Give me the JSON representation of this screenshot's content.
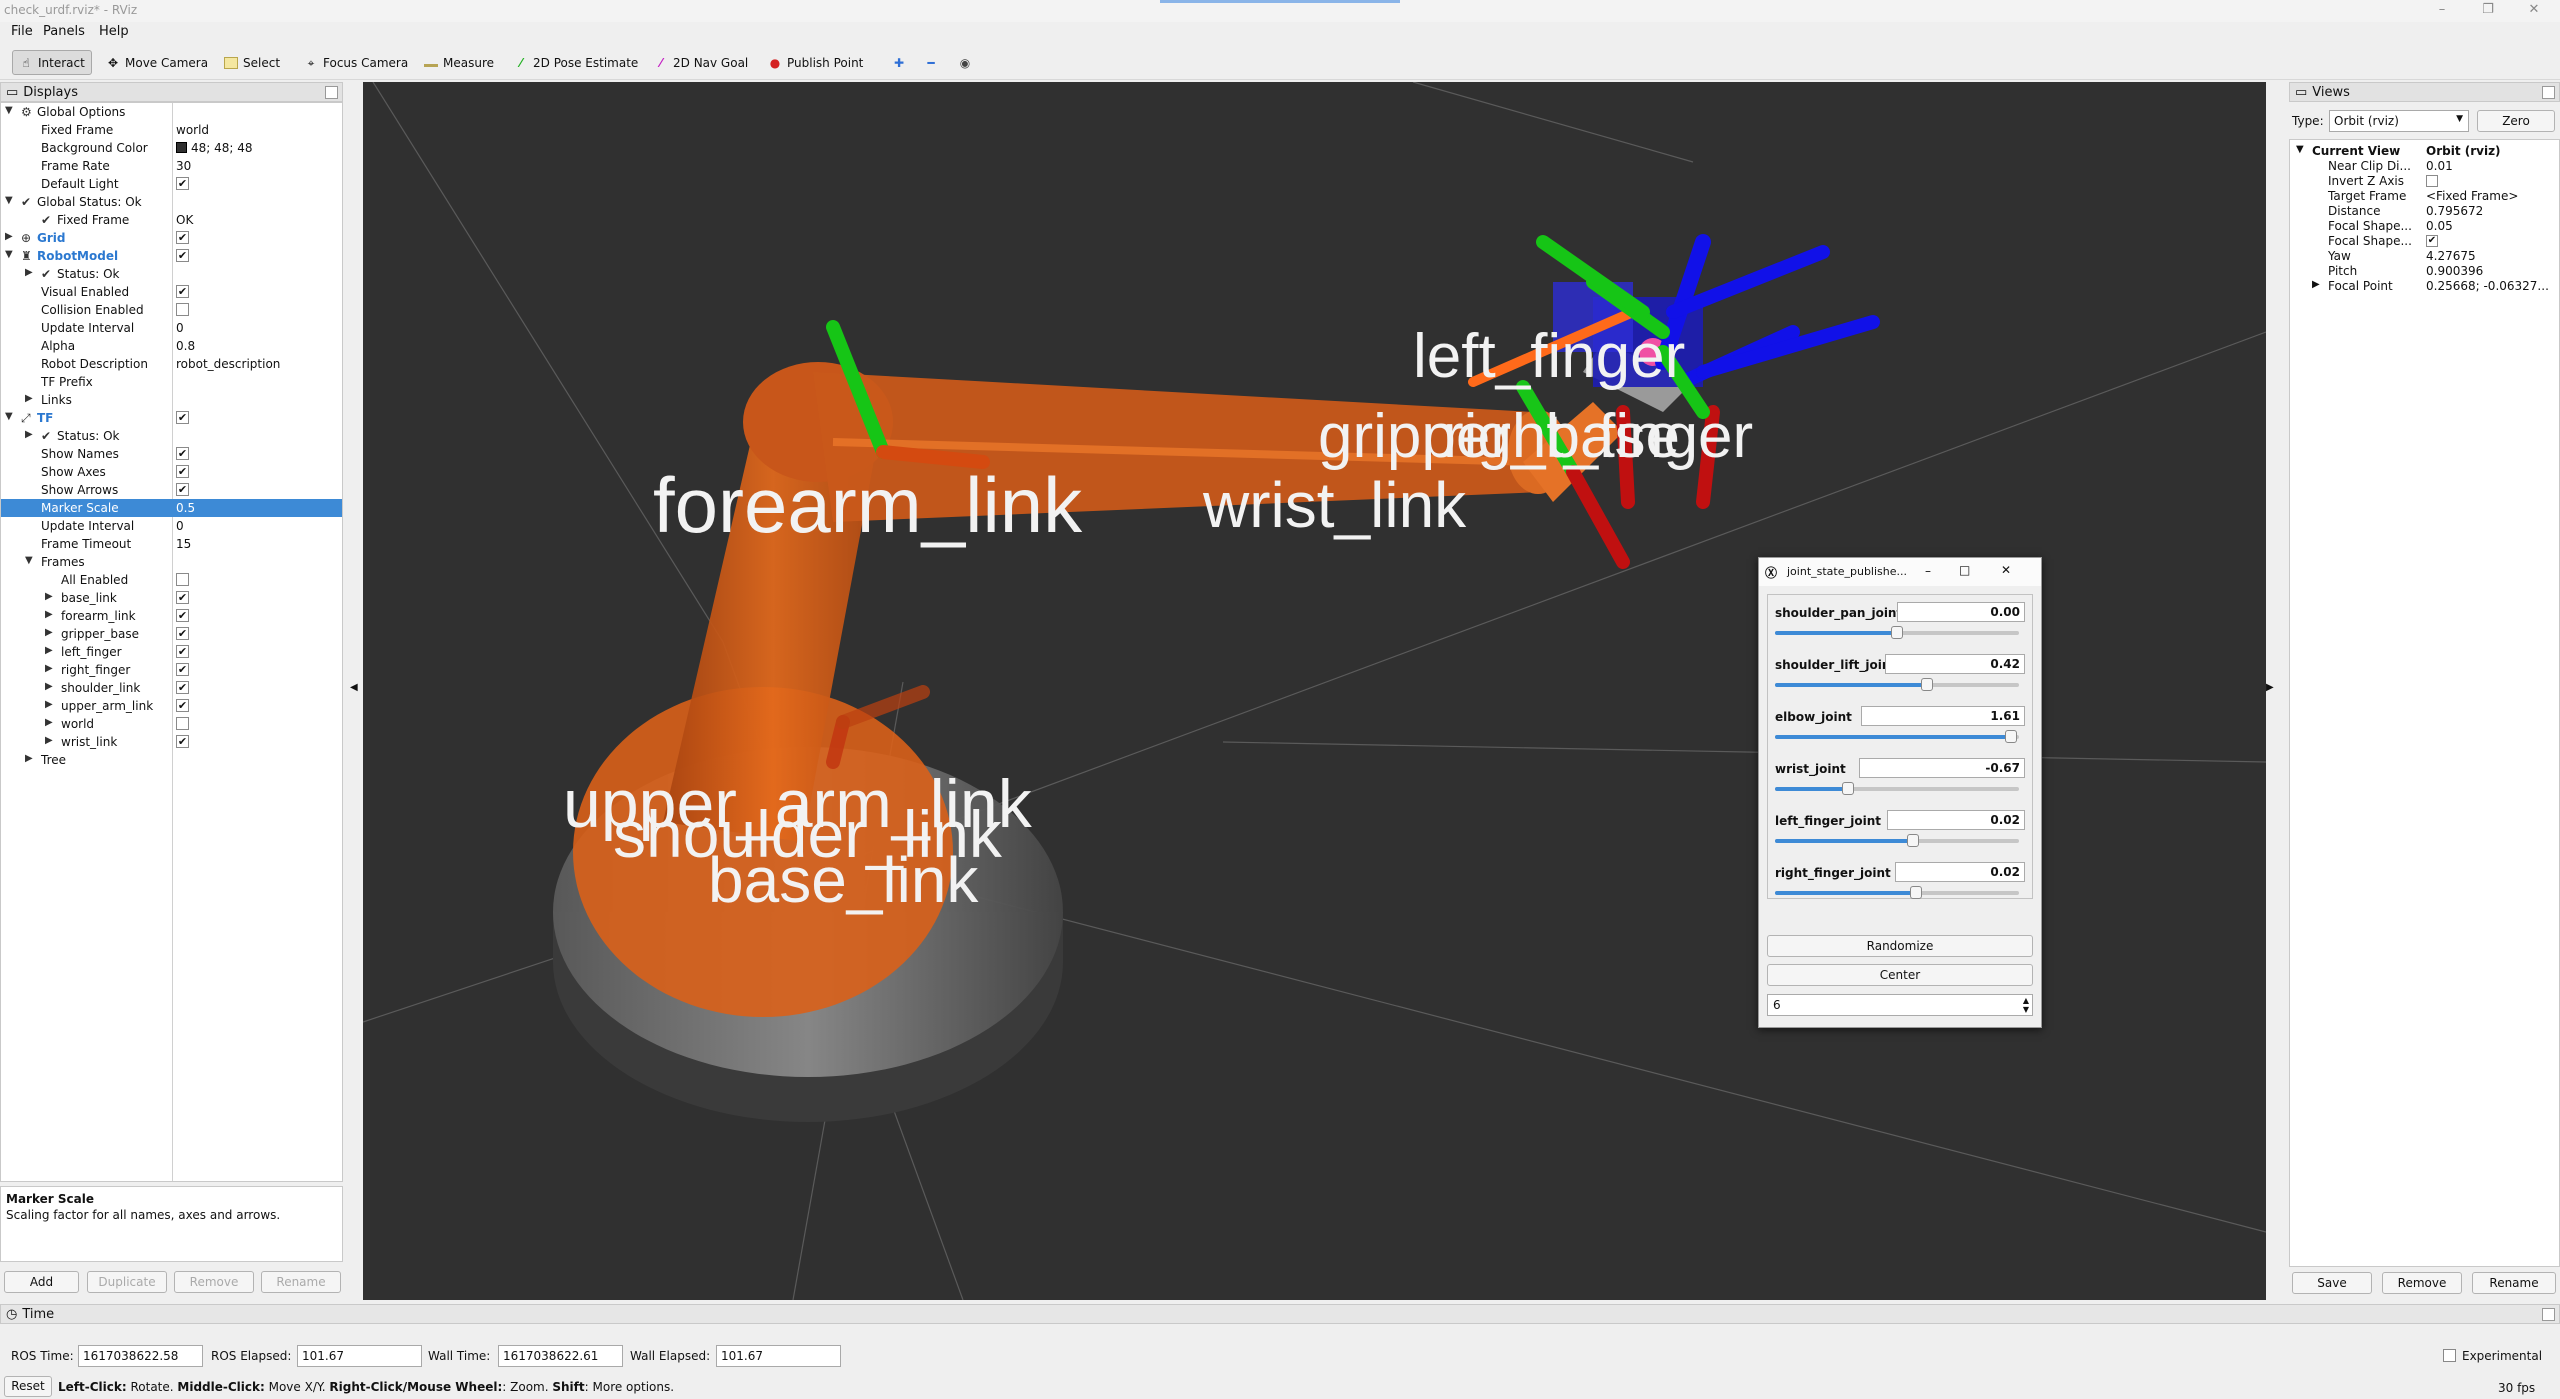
{
  "window": {
    "title": "check_urdf.rviz* - RViz"
  },
  "menu": [
    "File",
    "Panels",
    "Help"
  ],
  "toolbar": {
    "interact": "Interact",
    "move_camera": "Move Camera",
    "select": "Select",
    "focus_camera": "Focus Camera",
    "measure": "Measure",
    "pose_estimate": "2D Pose Estimate",
    "nav_goal": "2D Nav Goal",
    "publish_point": "Publish Point"
  },
  "displays": {
    "title": "Displays",
    "rows": [
      {
        "name": "global-options",
        "label": "Global Options",
        "value": "",
        "indent": 1,
        "arrow": "▼",
        "icon": "⚙",
        "check": null
      },
      {
        "name": "fixed-frame",
        "label": "Fixed Frame",
        "value": "world",
        "indent": 2,
        "arrow": "",
        "icon": "",
        "check": null
      },
      {
        "name": "background-color",
        "label": "Background Color",
        "value": "48; 48; 48",
        "indent": 2,
        "arrow": "",
        "icon": "",
        "check": null,
        "swatch": "#303030"
      },
      {
        "name": "frame-rate",
        "label": "Frame Rate",
        "value": "30",
        "indent": 2,
        "arrow": "",
        "icon": "",
        "check": null
      },
      {
        "name": "default-light",
        "label": "Default Light",
        "value": "",
        "indent": 2,
        "arrow": "",
        "icon": "",
        "check": true
      },
      {
        "name": "global-status",
        "label": "Global Status: Ok",
        "value": "",
        "indent": 1,
        "arrow": "▼",
        "icon": "✔",
        "check": null
      },
      {
        "name": "global-status-fixed-frame",
        "label": "Fixed Frame",
        "value": "OK",
        "indent": 2,
        "arrow": "",
        "icon": "✔",
        "check": null
      },
      {
        "name": "grid",
        "label": "Grid",
        "value": "",
        "indent": 1,
        "arrow": "▶",
        "icon": "⊕",
        "check": true,
        "blue": true
      },
      {
        "name": "robot-model",
        "label": "RobotModel",
        "value": "",
        "indent": 1,
        "arrow": "▼",
        "icon": "♜",
        "check": true,
        "blue": true
      },
      {
        "name": "robot-status",
        "label": "Status: Ok",
        "value": "",
        "indent": 2,
        "arrow": "▶",
        "icon": "✔",
        "check": null
      },
      {
        "name": "visual-enabled",
        "label": "Visual Enabled",
        "value": "",
        "indent": 2,
        "arrow": "",
        "icon": "",
        "check": true
      },
      {
        "name": "collision-enabled",
        "label": "Collision Enabled",
        "value": "",
        "indent": 2,
        "arrow": "",
        "icon": "",
        "check": false
      },
      {
        "name": "update-interval",
        "label": "Update Interval",
        "value": "0",
        "indent": 2,
        "arrow": "",
        "icon": "",
        "check": null
      },
      {
        "name": "alpha",
        "label": "Alpha",
        "value": "0.8",
        "indent": 2,
        "arrow": "",
        "icon": "",
        "check": null
      },
      {
        "name": "robot-description",
        "label": "Robot Description",
        "value": "robot_description",
        "indent": 2,
        "arrow": "",
        "icon": "",
        "check": null
      },
      {
        "name": "tf-prefix",
        "label": "TF Prefix",
        "value": "",
        "indent": 2,
        "arrow": "",
        "icon": "",
        "check": null
      },
      {
        "name": "links",
        "label": "Links",
        "value": "",
        "indent": 2,
        "arrow": "▶",
        "icon": "",
        "check": null
      },
      {
        "name": "tf",
        "label": "TF",
        "value": "",
        "indent": 1,
        "arrow": "▼",
        "icon": "⤢",
        "check": true,
        "blue": true
      },
      {
        "name": "tf-status",
        "label": "Status: Ok",
        "value": "",
        "indent": 2,
        "arrow": "▶",
        "icon": "✔",
        "check": null
      },
      {
        "name": "show-names",
        "label": "Show Names",
        "value": "",
        "indent": 2,
        "arrow": "",
        "icon": "",
        "check": true
      },
      {
        "name": "show-axes",
        "label": "Show Axes",
        "value": "",
        "indent": 2,
        "arrow": "",
        "icon": "",
        "check": true
      },
      {
        "name": "show-arrows",
        "label": "Show Arrows",
        "value": "",
        "indent": 2,
        "arrow": "",
        "icon": "",
        "check": true
      },
      {
        "name": "marker-scale",
        "label": "Marker Scale",
        "value": "0.5",
        "indent": 2,
        "arrow": "",
        "icon": "",
        "check": null,
        "selected": true
      },
      {
        "name": "tf-update-interval",
        "label": "Update Interval",
        "value": "0",
        "indent": 2,
        "arrow": "",
        "icon": "",
        "check": null
      },
      {
        "name": "frame-timeout",
        "label": "Frame Timeout",
        "value": "15",
        "indent": 2,
        "arrow": "",
        "icon": "",
        "check": null
      },
      {
        "name": "frames",
        "label": "Frames",
        "value": "",
        "indent": 2,
        "arrow": "▼",
        "icon": "",
        "check": null
      },
      {
        "name": "all-enabled",
        "label": "All Enabled",
        "value": "",
        "indent": 3,
        "arrow": "",
        "icon": "",
        "check": false
      },
      {
        "name": "frame-base-link",
        "label": "base_link",
        "value": "",
        "indent": 3,
        "arrow": "▶",
        "icon": "",
        "check": true
      },
      {
        "name": "frame-forearm-link",
        "label": "forearm_link",
        "value": "",
        "indent": 3,
        "arrow": "▶",
        "icon": "",
        "check": true
      },
      {
        "name": "frame-gripper-base",
        "label": "gripper_base",
        "value": "",
        "indent": 3,
        "arrow": "▶",
        "icon": "",
        "check": true
      },
      {
        "name": "frame-left-finger",
        "label": "left_finger",
        "value": "",
        "indent": 3,
        "arrow": "▶",
        "icon": "",
        "check": true
      },
      {
        "name": "frame-right-finger",
        "label": "right_finger",
        "value": "",
        "indent": 3,
        "arrow": "▶",
        "icon": "",
        "check": true
      },
      {
        "name": "frame-shoulder-link",
        "label": "shoulder_link",
        "value": "",
        "indent": 3,
        "arrow": "▶",
        "icon": "",
        "check": true
      },
      {
        "name": "frame-upper-arm-link",
        "label": "upper_arm_link",
        "value": "",
        "indent": 3,
        "arrow": "▶",
        "icon": "",
        "check": true
      },
      {
        "name": "frame-world",
        "label": "world",
        "value": "",
        "indent": 3,
        "arrow": "▶",
        "icon": "",
        "check": false
      },
      {
        "name": "frame-wrist-link",
        "label": "wrist_link",
        "value": "",
        "indent": 3,
        "arrow": "▶",
        "icon": "",
        "check": true
      },
      {
        "name": "tree",
        "label": "Tree",
        "value": "",
        "indent": 2,
        "arrow": "▶",
        "icon": "",
        "check": null
      }
    ],
    "desc_title": "Marker Scale",
    "desc_text": "Scaling factor for all names, axes and arrows.",
    "buttons": {
      "add": "Add",
      "duplicate": "Duplicate",
      "remove": "Remove",
      "rename": "Rename"
    }
  },
  "scene": {
    "labels": {
      "forearm": "forearm_link",
      "wrist": "wrist_link",
      "left_finger": "left_finger",
      "gripper_base": "gripper_base",
      "right_finger": "right_finger",
      "upper_arm": "upper_arm_link",
      "shoulder": "shoulder_link",
      "base": "base_link"
    }
  },
  "joint_state_publisher": {
    "title": "joint_state_publishe...",
    "joints": [
      {
        "name": "shoulder_pan_joint",
        "value": "0.00",
        "fraction": 0.5
      },
      {
        "name": "shoulder_lift_joint",
        "value": "0.42",
        "fraction": 0.63
      },
      {
        "name": "elbow_joint",
        "value": "1.61",
        "fraction": 0.99
      },
      {
        "name": "wrist_joint",
        "value": "-0.67",
        "fraction": 0.29
      },
      {
        "name": "left_finger_joint",
        "value": "0.02",
        "fraction": 0.57
      },
      {
        "name": "right_finger_joint",
        "value": "0.02",
        "fraction": 0.58
      }
    ],
    "randomize": "Randomize",
    "center": "Center",
    "spin_value": "6"
  },
  "views": {
    "title": "Views",
    "type_label": "Type:",
    "type_value": "Orbit (rviz)",
    "zero": "Zero",
    "current_view_label": "Current View",
    "current_view_value": "Orbit (rviz)",
    "props": [
      {
        "name": "near-clip",
        "label": "Near Clip Di...",
        "value": "0.01"
      },
      {
        "name": "invert-z",
        "label": "Invert Z Axis",
        "value": "",
        "check": false
      },
      {
        "name": "target-frame",
        "label": "Target Frame",
        "value": "<Fixed Frame>"
      },
      {
        "name": "distance",
        "label": "Distance",
        "value": "0.795672"
      },
      {
        "name": "focal-shape-size",
        "label": "Focal Shape...",
        "value": "0.05"
      },
      {
        "name": "focal-shape-fixed",
        "label": "Focal Shape...",
        "value": "",
        "check": true
      },
      {
        "name": "yaw",
        "label": "Yaw",
        "value": "4.27675"
      },
      {
        "name": "pitch",
        "label": "Pitch",
        "value": "0.900396"
      },
      {
        "name": "focal-point",
        "label": "Focal Point",
        "value": "0.25668; -0.06327...",
        "arrow": "▶"
      }
    ],
    "buttons": {
      "save": "Save",
      "remove": "Remove",
      "rename": "Rename"
    }
  },
  "time": {
    "title": "Time",
    "ros_time_label": "ROS Time:",
    "ros_time": "1617038622.58",
    "ros_elapsed_label": "ROS Elapsed:",
    "ros_elapsed": "101.67",
    "wall_time_label": "Wall Time:",
    "wall_time": "1617038622.61",
    "wall_elapsed_label": "Wall Elapsed:",
    "wall_elapsed": "101.67",
    "experimental": "Experimental",
    "reset": "Reset",
    "help_a": "Left-Click:",
    "help_b": " Rotate. ",
    "help_c": "Middle-Click:",
    "help_d": " Move X/Y. ",
    "help_e": "Right-Click/Mouse Wheel:",
    "help_f": ": Zoom. ",
    "help_g": "Shift",
    "help_h": ": More options.",
    "fps": "30 fps"
  }
}
